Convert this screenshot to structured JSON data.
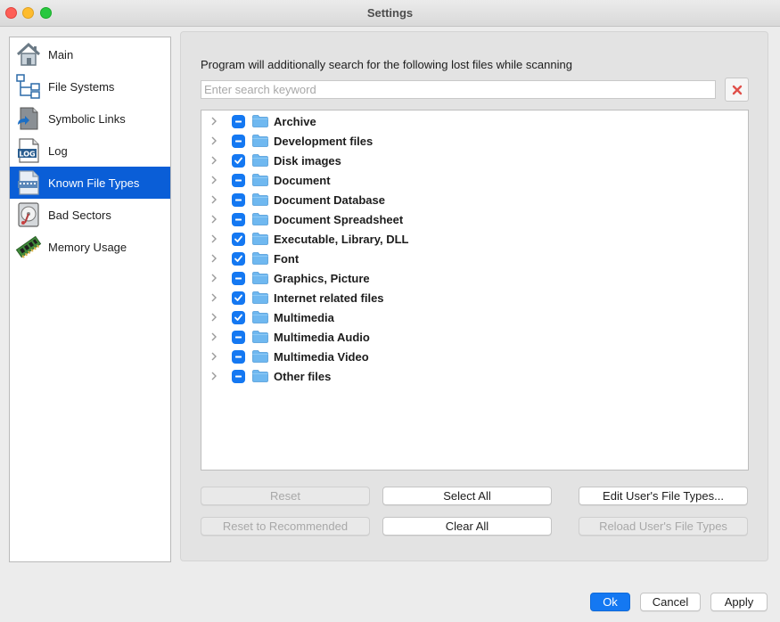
{
  "window": {
    "title": "Settings"
  },
  "sidebar": {
    "items": [
      {
        "label": "Main",
        "icon": "house-icon",
        "active": false
      },
      {
        "label": "File Systems",
        "icon": "file-tree-icon",
        "active": false
      },
      {
        "label": "Symbolic Links",
        "icon": "symbolic-link-icon",
        "active": false
      },
      {
        "label": "Log",
        "icon": "log-icon",
        "active": false
      },
      {
        "label": "Known File Types",
        "icon": "file-types-icon",
        "active": true
      },
      {
        "label": "Bad Sectors",
        "icon": "disk-icon",
        "active": false
      },
      {
        "label": "Memory Usage",
        "icon": "memory-chip-icon",
        "active": false
      }
    ]
  },
  "panel": {
    "description": "Program will additionally search for the following lost files while scanning",
    "search_placeholder": "Enter search keyword",
    "search_value": ""
  },
  "tree": {
    "items": [
      {
        "label": "Archive",
        "state": "partial"
      },
      {
        "label": "Development files",
        "state": "partial"
      },
      {
        "label": "Disk images",
        "state": "checked"
      },
      {
        "label": "Document",
        "state": "partial"
      },
      {
        "label": "Document Database",
        "state": "partial"
      },
      {
        "label": "Document Spreadsheet",
        "state": "partial"
      },
      {
        "label": "Executable, Library, DLL",
        "state": "checked"
      },
      {
        "label": "Font",
        "state": "checked"
      },
      {
        "label": "Graphics, Picture",
        "state": "partial"
      },
      {
        "label": "Internet related files",
        "state": "checked"
      },
      {
        "label": "Multimedia",
        "state": "checked"
      },
      {
        "label": "Multimedia Audio",
        "state": "partial"
      },
      {
        "label": "Multimedia Video",
        "state": "partial"
      },
      {
        "label": "Other files",
        "state": "partial"
      }
    ]
  },
  "buttons": {
    "reset": "Reset",
    "select_all": "Select All",
    "edit_user_types": "Edit User's File Types...",
    "reset_recommended": "Reset to Recommended",
    "clear_all": "Clear All",
    "reload_user_types": "Reload User's File Types",
    "ok": "Ok",
    "cancel": "Cancel",
    "apply": "Apply"
  },
  "colors": {
    "accent": "#0a5ed7",
    "checkbox": "#1478f2",
    "folder": "#6fb8f0",
    "clear_x": "#e0504a"
  }
}
